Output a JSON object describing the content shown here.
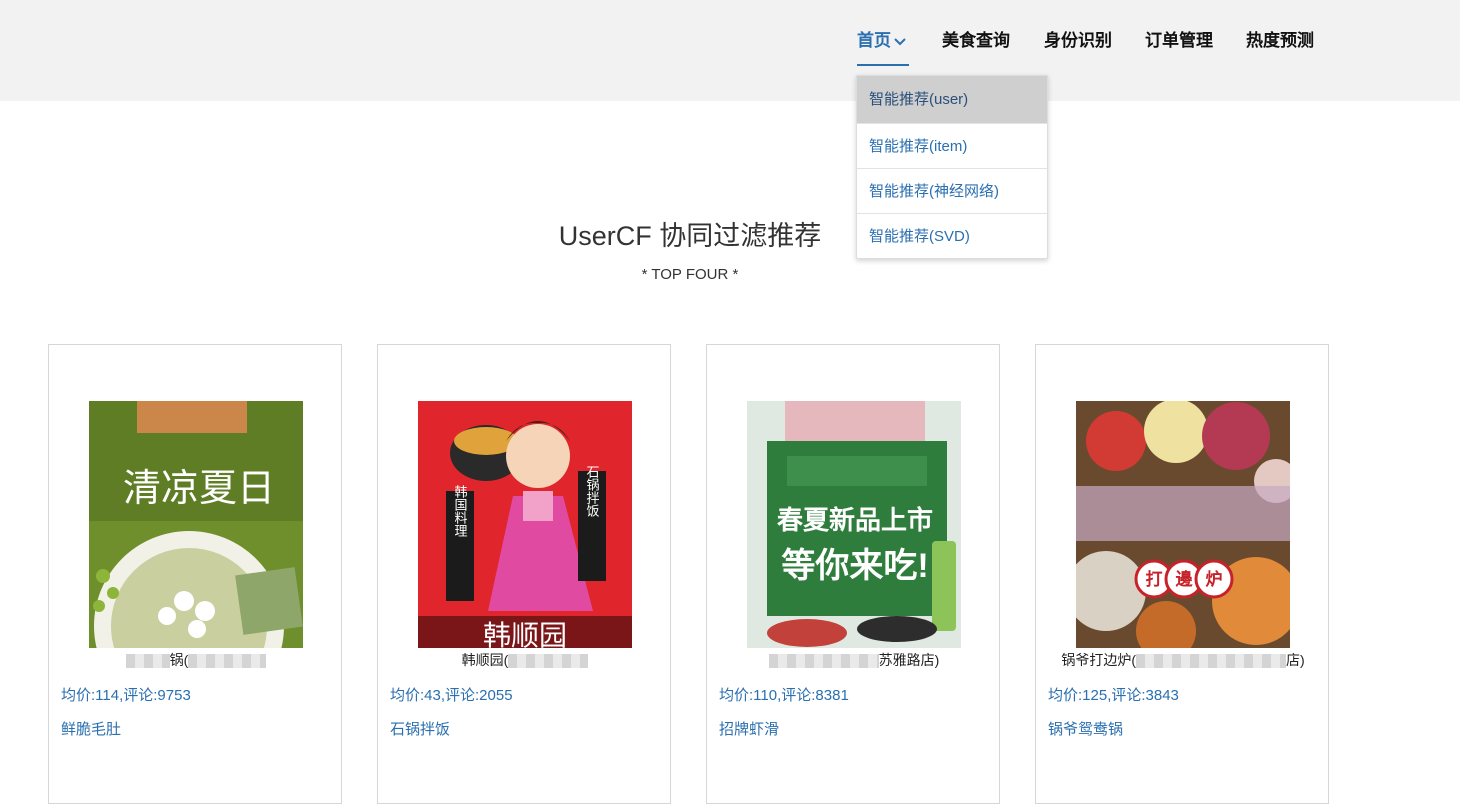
{
  "nav": {
    "items": [
      "首页",
      "美食查询",
      "身份识别",
      "订单管理",
      "热度预测"
    ]
  },
  "dropdown": {
    "items": [
      "智能推荐(user)",
      "智能推荐(item)",
      "智能推荐(神经网络)",
      "智能推荐(SVD)"
    ]
  },
  "heading": {
    "title": "UserCF 协同过滤推荐",
    "subtitle": "* TOP FOUR *"
  },
  "cards": [
    {
      "name_pre": "",
      "name_post": "锅(",
      "price": "均价:114,评论:9753",
      "dish": "鲜脆毛肚",
      "poster_text": "清凉夏日"
    },
    {
      "name_pre": "韩顺园(",
      "name_post": "",
      "price": "均价:43,评论:2055",
      "dish": "石锅拌饭",
      "poster_left": "韩国料理",
      "poster_right": "石锅拌饭",
      "poster_bottom": "韩顺园"
    },
    {
      "name_pre": "",
      "name_post": "苏雅路店)",
      "price": "均价:110,评论:8381",
      "dish": "招牌虾滑",
      "poster_line1": "春夏新品上市",
      "poster_line2": "等你来吃!"
    },
    {
      "name_pre": "锅爷打边炉(",
      "name_post": "店)",
      "price": "均价:125,评论:3843",
      "dish": "锅爷鸳鸯锅",
      "poster_badge": [
        "打",
        "邊",
        "炉"
      ]
    }
  ]
}
